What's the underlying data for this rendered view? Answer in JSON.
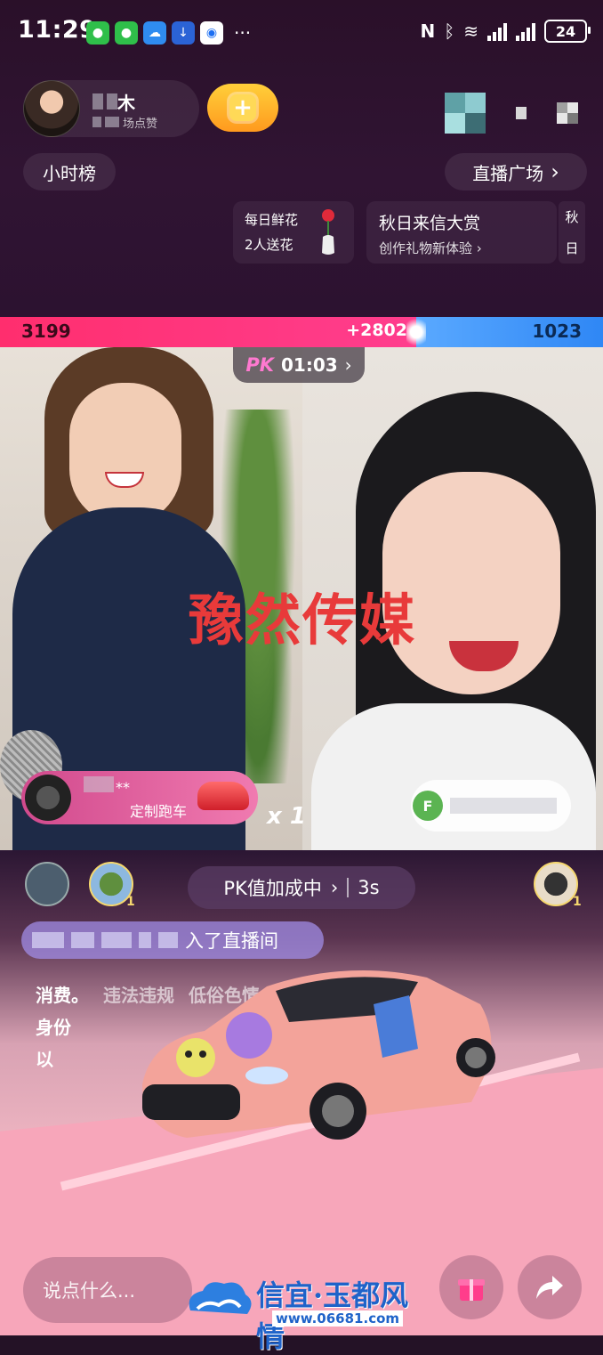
{
  "status_bar": {
    "time": "11:29",
    "battery": "24"
  },
  "host": {
    "name": "木",
    "subtitle": "场点赞"
  },
  "header": {
    "hour_rank": "小时榜",
    "live_square": "直播广场"
  },
  "promos": [
    {
      "line1": "每日鲜花",
      "line2": "2人送花"
    },
    {
      "line1": "秋日来信大赏",
      "line2": "创作礼物新体验"
    },
    {
      "line1": "秋",
      "line2": "日"
    }
  ],
  "pk": {
    "left_score": "3199",
    "right_score": "1023",
    "bonus": "+2802",
    "logo": "PK",
    "timer": "01:03",
    "left_share": 0.69
  },
  "center_watermark": "豫然传媒",
  "gift_left": {
    "name": "**",
    "gift": "定制跑车"
  },
  "gift_combo": "x 1",
  "gift_right": {
    "badge": "F"
  },
  "team": {
    "left_count": "1",
    "right_count": "1"
  },
  "pk_bonus_pill": {
    "text": "PK值加成中",
    "seconds": "3s"
  },
  "enter_msg": "入了直播间",
  "notice": {
    "line1a": "消费。",
    "line1b": "违法违规",
    "line1c": "低俗色情、吸烟",
    "line2": "身份",
    "line3": "以"
  },
  "bottom": {
    "input_placeholder": "说点什么..."
  },
  "site_watermark": {
    "name": "信宜·玉都风情",
    "url": "www.06681.com"
  },
  "colors": {
    "pk_red": "#ff2e6e",
    "pk_blue": "#2f87f5",
    "gold": "#ffb02e"
  }
}
